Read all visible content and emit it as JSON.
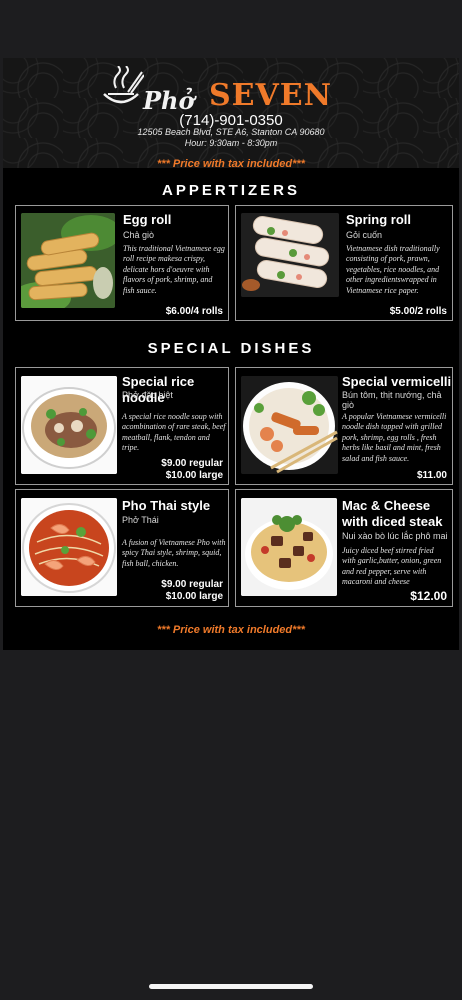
{
  "restaurant": {
    "logo_pho": "Phở",
    "logo_seven": "SEVEN",
    "phone": "(714)-901-0350",
    "address": "12505 Beach Blvd, STE A6, Stanton CA 90680",
    "hours": "Hour: 9:30am - 8:30pm"
  },
  "notes": {
    "top": "*** Price with tax included***",
    "bottom": "*** Price with tax included***"
  },
  "sections": {
    "appetizers": "APPERTIZERS",
    "special": "SPECIAL DISHES"
  },
  "items": {
    "egg_roll": {
      "name": "Egg roll",
      "viet": "Chả giò",
      "desc": "This traditional Vietnamese egg roll recipe makesa crispy, delicate hors d'oeuvre with flavors of pork, shrimp, and fish sauce.",
      "price": "$6.00/4 rolls"
    },
    "spring_roll": {
      "name": "Spring roll",
      "viet": "Gỏi cuốn",
      "desc": "Vietnamese dish traditionally consisting of pork, prawn, vegetables, rice noodles, and other ingredientswrapped in Vietnamese rice paper.",
      "price": "$5.00/2 rolls"
    },
    "rice_noodle": {
      "name": "Special rice noodle",
      "viet": "Phở đặc biệt",
      "desc": "A special rice noodle soup with acombination of rare steak, beef meatball, flank, tendon and tripe.",
      "price_regular": "$9.00 regular",
      "price_large": "$10.00 large"
    },
    "vermicelli": {
      "name": "Special vermicelli",
      "viet": "Bún tôm, thịt nướng, chả giò",
      "desc": "A popular Vietnamese vermicelli noodle dish topped with grilled pork, shrimp, egg rolls , fresh herbs like basil and mint, fresh salad and fish sauce.",
      "price": "$11.00"
    },
    "pho_thai": {
      "name": "Pho Thai style",
      "viet": "Phở Thái",
      "desc": "A fusion of Vietnamese Pho with spicy Thai style, shrimp, squid, fish ball, chicken.",
      "price_regular": "$9.00 regular",
      "price_large": "$10.00 large"
    },
    "mac_cheese": {
      "name": "Mac & Cheese with diced steak",
      "viet": "Nui xào bò lúc lắc phô mai",
      "desc": "Juicy diced beef stirred fried with garlic,butter, onion, green and red pepper, serve with macaroni and cheese",
      "price": "$12.00"
    }
  }
}
